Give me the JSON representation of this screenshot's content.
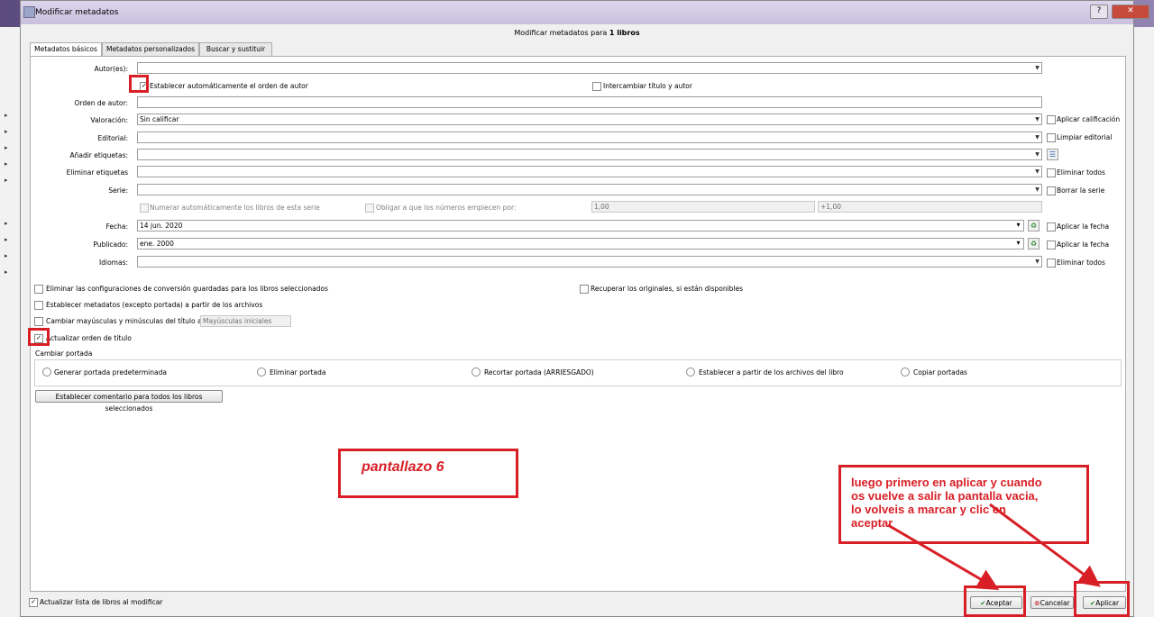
{
  "window": {
    "title": "Modificar metadatos",
    "header_prefix": "Modificar metadatos para ",
    "header_bold": "1 libros"
  },
  "tabs": [
    {
      "label": "Metadatos básicos"
    },
    {
      "label": "Metadatos personalizados"
    },
    {
      "label": "Buscar y sustituir"
    }
  ],
  "fields": {
    "autores": {
      "label": "Autor(es):",
      "value": ""
    },
    "auto_author_order": {
      "label": "Establecer automáticamente el orden de autor",
      "checked": true
    },
    "swap_title_author": {
      "label": "Intercambiar título y autor",
      "checked": false
    },
    "orden_autor": {
      "label": "Orden de autor:",
      "value": ""
    },
    "valoracion": {
      "label": "Valoración:",
      "value": "Sin calificar",
      "side_label": "Aplicar calificación"
    },
    "editorial": {
      "label": "Editorial:",
      "value": "",
      "side_label": "Limpiar editorial"
    },
    "anadir_etiquetas": {
      "label": "Añadir etiquetas:",
      "value": ""
    },
    "eliminar_etiquetas": {
      "label": "Eliminar etiquetas",
      "value": "",
      "side_label": "Eliminar todos"
    },
    "serie": {
      "label": "Serie:",
      "value": "",
      "side_label": "Borrar la serie"
    },
    "numerar": {
      "label": "Numerar automáticamente los libros de esta serie"
    },
    "obligar": {
      "label": "Obligar a que los números empiecen por:"
    },
    "num_start": "1,00",
    "num_inc": "+1,00",
    "fecha": {
      "label": "Fecha:",
      "value": "14 jun. 2020",
      "side_label": "Aplicar la fecha"
    },
    "publicado": {
      "label": "Publicado:",
      "value": "ene. 2000",
      "side_label": "Aplicar la fecha"
    },
    "idiomas": {
      "label": "Idiomas:",
      "value": "",
      "side_label": "Eliminar todos"
    }
  },
  "options": {
    "eliminar_conv": "Eliminar las configuraciones de conversión guardadas para los libros seleccionados",
    "recuperar": "Recuperar los originales, si están disponibles",
    "establecer_meta": "Establecer metadatos (excepto portada) a partir de los archivos",
    "cambiar_mayus": "Cambiar mayúsculas y minúsculas del título a:",
    "mayus_value": "Mayúsculas iniciales",
    "actualizar_orden": {
      "label": "Actualizar orden de título",
      "checked": true
    }
  },
  "portada": {
    "title": "Cambiar portada",
    "options": [
      "Generar portada predeterminada",
      "Eliminar portada",
      "Recortar portada (ARRIESGADO)",
      "Establecer a partir de los archivos del libro",
      "Copiar portadas"
    ]
  },
  "comment_button": "Establecer comentario para todos los libros seleccionados",
  "footer": {
    "refresh": {
      "label": "Actualizar lista de libros al modificar",
      "checked": true
    },
    "accept": "Aceptar",
    "cancel": "Cancelar",
    "apply": "Aplicar"
  },
  "annotations": {
    "screenshot_label": "pantallazo 6",
    "note_lines": [
      "luego primero en aplicar y cuando",
      "os vuelve a salir la pantalla vacia,",
      "lo volveis a marcar y clic en",
      "aceptar"
    ]
  },
  "colors": {
    "annotation_red": "#d81f26",
    "panel": "#ffffff",
    "window": "#f0f0f0"
  }
}
